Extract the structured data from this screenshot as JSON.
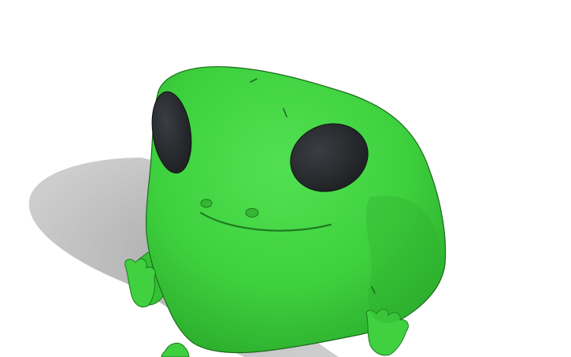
{
  "model_viewer": {
    "background_color": "#ffffff",
    "model": {
      "subject": "frog",
      "body_color": "#3ed13e",
      "body_shade_color": "#27a827",
      "eye_color": "#26292c",
      "shadow_color": "#a8a8a8"
    }
  }
}
